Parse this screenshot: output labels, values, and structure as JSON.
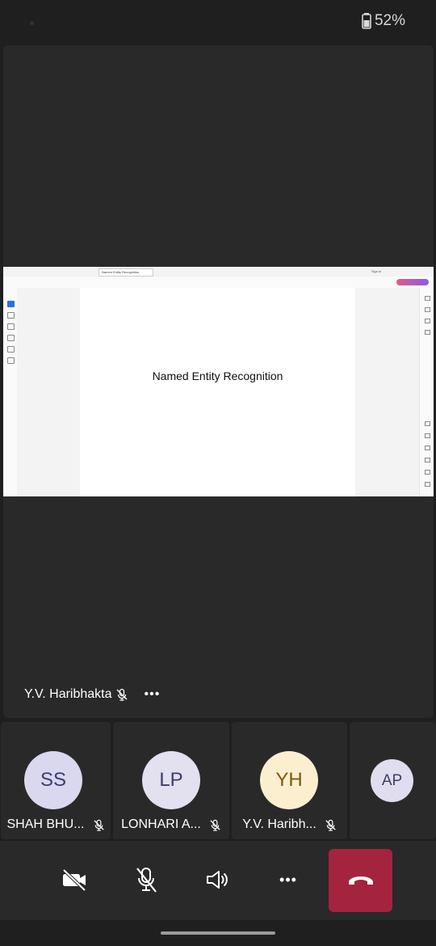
{
  "status": {
    "battery": "52%"
  },
  "share": {
    "page_title": "Named Entity Recognition",
    "tab_label": "Named Entity Recognition",
    "ai_button": "AI Assistant",
    "signin": "Sign in"
  },
  "presenter": {
    "name": "Y.V. Haribhakta",
    "more": "•••"
  },
  "participants": [
    {
      "initials": "SS",
      "name": "SHAH BHU...",
      "bg": "#d9d8ef",
      "fg": "#3d3d6b"
    },
    {
      "initials": "LP",
      "name": "LONHARI A...",
      "bg": "#e3e0ef",
      "fg": "#3d3d6b"
    },
    {
      "initials": "YH",
      "name": "Y.V. Haribh...",
      "bg": "#fbefcf",
      "fg": "#7a5a12"
    },
    {
      "initials": "AP",
      "bg": "#e0ddef",
      "fg": "#3d3d6b"
    }
  ],
  "controls": {
    "more": "•••"
  },
  "colors": {
    "hangup": "#a4233e",
    "background": "#1f1f1f",
    "tile": "#292929"
  },
  "icons": [
    "battery-icon",
    "mic-off-icon",
    "video-off-icon",
    "speaker-icon",
    "more-icon",
    "hang-up-icon"
  ]
}
